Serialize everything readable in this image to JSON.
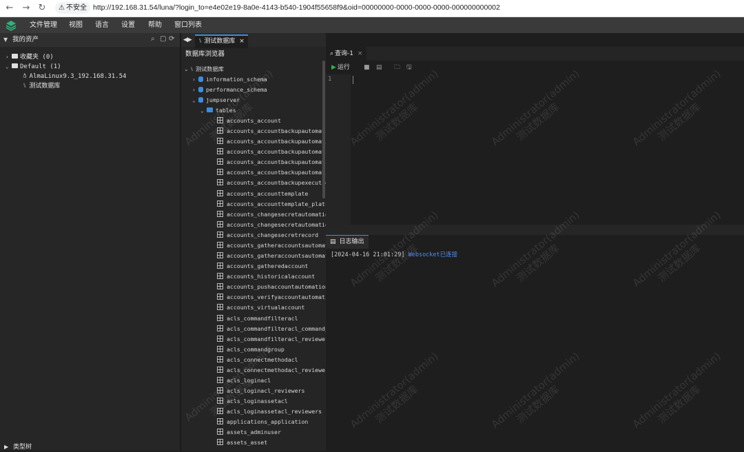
{
  "browser": {
    "security_label": "不安全",
    "url": "http://192.168.31.54/luna/?login_to=e4e02e19-8a0e-4143-b540-1904f55658f9&oid=00000000-0000-0000-0000-000000000002"
  },
  "menu": [
    "文件管理",
    "视图",
    "语言",
    "设置",
    "帮助",
    "窗口列表"
  ],
  "assets": {
    "title": "我的资产",
    "favorites": "收藏夹 (0)",
    "default_group": "Default (1)",
    "host": "AlmaLinux9.3_192.168.31.54",
    "database": "测试数据库",
    "bottom": "类型树"
  },
  "db_tab": "测试数据库",
  "db_browser": {
    "title": "数据库浏览器",
    "root": "测试数据库",
    "schemas": [
      "information_schema",
      "performance_schema",
      "jumpserver"
    ],
    "tables_folder": "tables",
    "tables": [
      "accounts_account",
      "accounts_accountbackupautomatio",
      "accounts_accountbackupautomatio",
      "accounts_accountbackupautomatio",
      "accounts_accountbackupautomatio",
      "accounts_accountbackupautomatio",
      "accounts_accountbackupexecution",
      "accounts_accounttemplate",
      "accounts_accounttemplate_platfo",
      "accounts_changesecretautomation",
      "accounts_changesecretautomation",
      "accounts_changesecretrecord",
      "accounts_gatheraccountsautomati",
      "accounts_gatheraccountsautomati",
      "accounts_gatheredaccount",
      "accounts_historicalaccount",
      "accounts_pushaccountautomation",
      "accounts_verifyaccountautomatio",
      "accounts_virtualaccount",
      "acls_commandfilteracl",
      "acls_commandfilteracl_command_g",
      "acls_commandfilteracl_reviewers",
      "acls_commandgroup",
      "acls_connectmethodacl",
      "acls_connectmethodacl_reviewers",
      "acls_loginacl",
      "acls_loginacl_reviewers",
      "acls_loginassetacl",
      "acls_loginassetacl_reviewers",
      "applications_application",
      "assets_adminuser",
      "assets_asset"
    ]
  },
  "editor": {
    "tab": "查询-1",
    "run": "运行",
    "line_number": "1"
  },
  "log": {
    "tab": "日志输出",
    "timestamp": "[2024-04-16 21:01:29]",
    "message": "Websocket已连接"
  },
  "watermark": {
    "line1": "Administrator(admin)",
    "line2": "测试数据库"
  },
  "colors": {
    "accent": "#3c8dde",
    "run_green": "#33b249",
    "log_link": "#4f8ff7"
  }
}
